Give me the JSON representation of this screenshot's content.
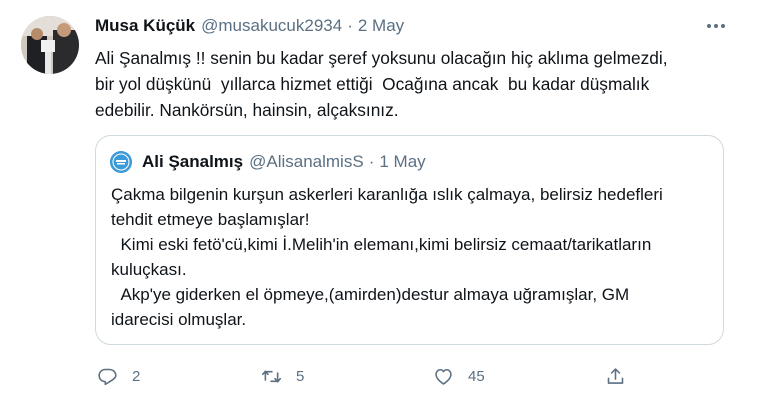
{
  "tweet": {
    "author_name": "Musa Küçük",
    "author_handle": "@musakucuk2934",
    "separator": "·",
    "date": "2 May",
    "text": "Ali Şanalmış !! senin bu kadar şeref yoksunu olacağın hiç aklıma gelmezdi,\nbir yol düşkünü  yıllarca hizmet ettiği  Ocağına ancak  bu kadar düşmalık\nedebilir. Nankörsün, hainsin, alçaksınız."
  },
  "quoted_tweet": {
    "author_name": "Ali Şanalmış",
    "author_handle": "@AlisanalmisS",
    "separator": "·",
    "date": "1 May",
    "text": "Çakma bilgenin kurşun askerleri karanlığa ıslık çalmaya, belirsiz hedefleri\ntehdit etmeye başlamışlar!\n  Kimi eski fetö'cü,kimi İ.Melih'in elemanı,kimi belirsiz cemaat/tarikatların\nkuluçkası.\n  Akp'ye giderken el öpmeye,(amirden)destur almaya uğramışlar, GM\nidarecisi olmuşlar."
  },
  "actions": {
    "reply_count": "2",
    "retweet_count": "5",
    "like_count": "45"
  },
  "icons": {
    "more": "more-horizontal-icon",
    "reply": "reply-icon",
    "retweet": "retweet-icon",
    "like": "heart-icon",
    "share": "share-icon"
  },
  "colors": {
    "text": "#0f1419",
    "secondary": "#5b7083",
    "border": "#cfd9de"
  }
}
